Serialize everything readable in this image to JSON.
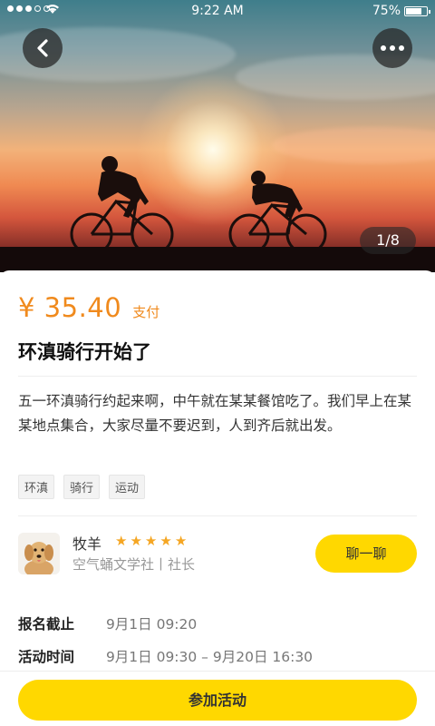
{
  "status_bar": {
    "time": "9:22 AM",
    "battery_text": "75%",
    "battery_level": 0.75,
    "signal_bars_filled": 3,
    "signal_bars_total": 5
  },
  "hero": {
    "pager_text": "1/8",
    "icons": {
      "back": "chevron-left-icon",
      "more": "more-horizontal-icon"
    }
  },
  "event": {
    "price": "¥ 35.40",
    "pay_label": "支付",
    "title": "环滇骑行开始了",
    "description": "五一环滇骑行约起来啊，中午就在某某餐馆吃了。我们早上在某某地点集合，大家尽量不要迟到，人到齐后就出发。",
    "tags": [
      "环滇",
      "骑行",
      "运动"
    ]
  },
  "organizer": {
    "name": "牧羊",
    "rating": 5,
    "rating_max": 5,
    "org": "空气蛹文学社丨社长",
    "chat_label": "聊一聊"
  },
  "info": {
    "signup_deadline_label": "报名截止",
    "signup_deadline_value": "9月1日 09:20",
    "activity_time_label": "活动时间",
    "activity_time_value": "9月1日 09:30 – 9月20日 16:30"
  },
  "actions": {
    "join_label": "参加活动"
  },
  "colors": {
    "accent_yellow": "#ffd800",
    "price_orange": "#f08a1d",
    "star": "#f5a623"
  }
}
